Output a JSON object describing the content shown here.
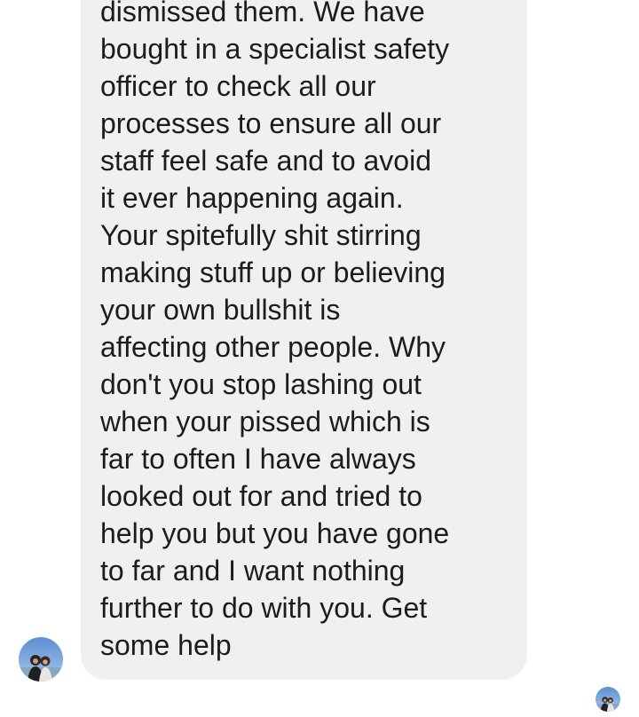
{
  "conversation": {
    "message": {
      "lines": [
        "dismissed them. We have",
        "bought in a specialist safety",
        "officer to check all our",
        "processes to ensure all our",
        "staff feel safe and to avoid",
        "it ever happening again.",
        "Your spitefully shit stirring",
        "making stuff up or believing",
        "your own bullshit is",
        "affecting other people. Why",
        "don't you stop lashing out",
        "when your pissed which is",
        "far to often I have always",
        "looked out for and tried to",
        "help you but you have gone",
        "to far and I want nothing",
        "further to do with you. Get",
        "some help"
      ]
    },
    "sender_avatar": {
      "icon": "profile-photo-icon"
    },
    "read_receipt": {
      "icon": "read-receipt-avatar-icon"
    }
  },
  "colors": {
    "bubble_bg": "#f0f0f0",
    "text": "#1c1c1c",
    "page_bg": "#ffffff"
  }
}
